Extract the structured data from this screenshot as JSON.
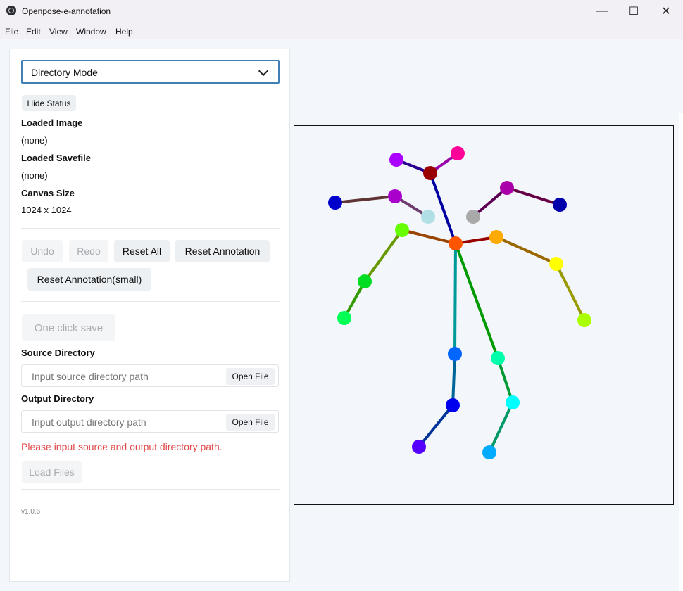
{
  "window": {
    "title": "Openpose-e-annotation",
    "minimize": "—",
    "maximize": "☐",
    "close": "✕"
  },
  "menu": [
    "File",
    "Edit",
    "View",
    "Window",
    "Help"
  ],
  "panel": {
    "mode_select": "Directory Mode",
    "hide_status": "Hide Status",
    "loaded_image_label": "Loaded Image",
    "loaded_image_value": "(none)",
    "loaded_savefile_label": "Loaded Savefile",
    "loaded_savefile_value": "(none)",
    "canvas_size_label": "Canvas Size",
    "canvas_size_value": "1024 x 1024",
    "undo": "Undo",
    "redo": "Redo",
    "reset_all": "Reset All",
    "reset_annotation": "Reset Annotation",
    "reset_annotation_small": "Reset Annotation(small)",
    "one_click_save": "One click save",
    "source_dir_label": "Source Directory",
    "source_dir_placeholder": "Input source directory path",
    "output_dir_label": "Output Directory",
    "output_dir_placeholder": "Input output directory path",
    "open_file": "Open File",
    "error": "Please input source and output directory path.",
    "load_files": "Load Files",
    "version": "v1.0.6"
  },
  "pose": {
    "colors": {
      "nose": "#ff6a00",
      "neck": "#8b0000",
      "head": "#9a0000"
    }
  }
}
